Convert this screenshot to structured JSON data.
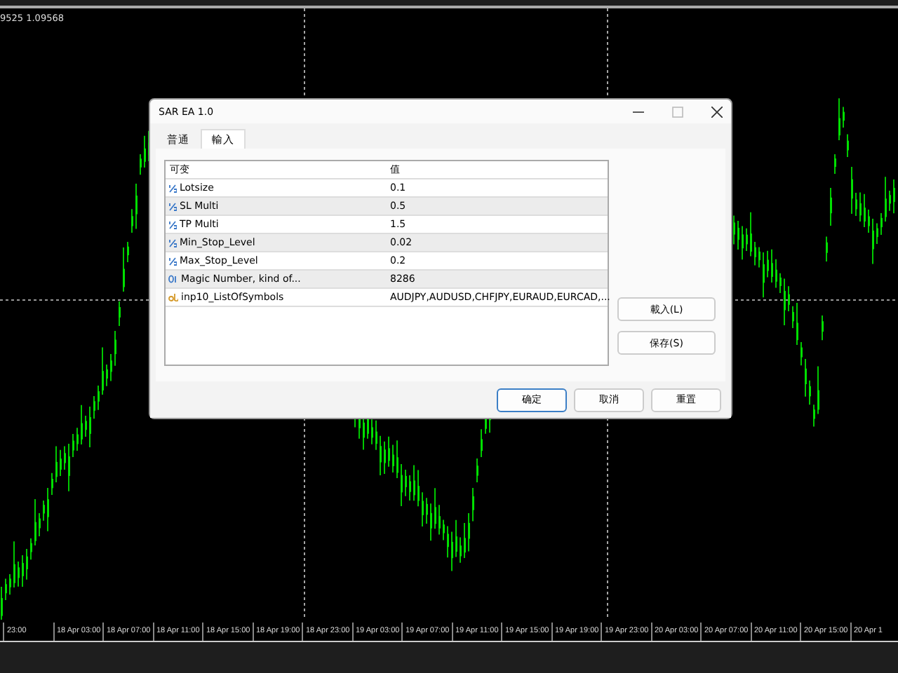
{
  "chart": {
    "header": "9525 1.09568",
    "time_labels": [
      "23:00",
      "18 Apr 03:00",
      "18 Apr 07:00",
      "18 Apr 11:00",
      "18 Apr 15:00",
      "18 Apr 19:00",
      "18 Apr 23:00",
      "19 Apr 03:00",
      "19 Apr 07:00",
      "19 Apr 11:00",
      "19 Apr 15:00",
      "19 Apr 19:00",
      "19 Apr 23:00",
      "20 Apr 03:00",
      "20 Apr 07:00",
      "20 Apr 11:00",
      "20 Apr 15:00",
      "20 Apr 1"
    ]
  },
  "dialog": {
    "title": "SAR EA 1.0",
    "tabs": [
      {
        "label": "普通",
        "selected": false
      },
      {
        "label": "輸入",
        "selected": true
      }
    ],
    "table": {
      "columns": [
        "可变",
        "值"
      ],
      "rows": [
        {
          "kind": "double",
          "name": "Lotsize",
          "value": "0.1"
        },
        {
          "kind": "double",
          "name": "SL Multi",
          "value": "0.5"
        },
        {
          "kind": "double",
          "name": "TP Multi",
          "value": "1.5"
        },
        {
          "kind": "double",
          "name": "Min_Stop_Level",
          "value": "0.02"
        },
        {
          "kind": "double",
          "name": "Max_Stop_Level",
          "value": "0.2"
        },
        {
          "kind": "int",
          "name": "Magic Number, kind of...",
          "value": "8286"
        },
        {
          "kind": "string",
          "name": "inp10_ListOfSymbols",
          "value": "AUDJPY,AUDUSD,CHFJPY,EURAUD,EURCAD,..."
        }
      ]
    },
    "side_buttons": [
      "載入(L)",
      "保存(S)"
    ],
    "buttons": [
      {
        "label": "确定",
        "default": true
      },
      {
        "label": "取消",
        "default": false
      },
      {
        "label": "重置",
        "default": false
      }
    ]
  }
}
